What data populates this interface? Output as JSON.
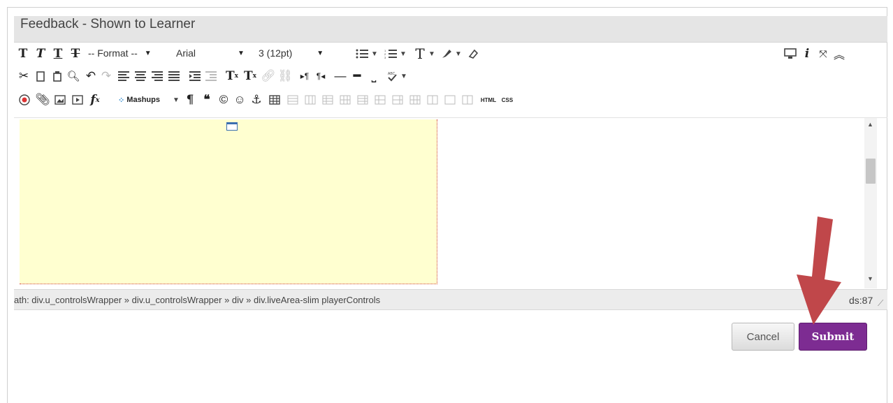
{
  "header": {
    "title": "Feedback - Shown to Learner"
  },
  "toolbar1": {
    "format_label": "-- Format --",
    "font_label": "Arial",
    "size_label": "3 (12pt)",
    "dropdown_arrow": "▾"
  },
  "toolbar3": {
    "mashups_label": "Mashups",
    "html_label": "HTML",
    "css_label": "CSS"
  },
  "path_bar": {
    "path_text": "ath: div.u_controlsWrapper » div.u_controlsWrapper » div » div.liveArea-slim playerControls",
    "words_text": "ds:87"
  },
  "actions": {
    "cancel_label": "Cancel",
    "submit_label": "Submit"
  },
  "annotation": {
    "arrow_color": "#c0474a"
  },
  "colors": {
    "submit_bg": "#7d2c92",
    "live_area_bg": "#ffffd0"
  }
}
